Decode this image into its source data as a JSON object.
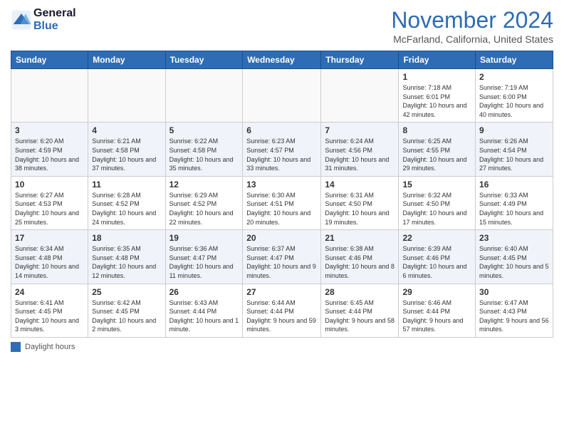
{
  "header": {
    "logo_line1": "General",
    "logo_line2": "Blue",
    "month_title": "November 2024",
    "location": "McFarland, California, United States"
  },
  "legend": {
    "label": "Daylight hours"
  },
  "days_of_week": [
    "Sunday",
    "Monday",
    "Tuesday",
    "Wednesday",
    "Thursday",
    "Friday",
    "Saturday"
  ],
  "weeks": [
    [
      {
        "num": "",
        "info": ""
      },
      {
        "num": "",
        "info": ""
      },
      {
        "num": "",
        "info": ""
      },
      {
        "num": "",
        "info": ""
      },
      {
        "num": "",
        "info": ""
      },
      {
        "num": "1",
        "info": "Sunrise: 7:18 AM\nSunset: 6:01 PM\nDaylight: 10 hours and 42 minutes."
      },
      {
        "num": "2",
        "info": "Sunrise: 7:19 AM\nSunset: 6:00 PM\nDaylight: 10 hours and 40 minutes."
      }
    ],
    [
      {
        "num": "3",
        "info": "Sunrise: 6:20 AM\nSunset: 4:59 PM\nDaylight: 10 hours and 38 minutes."
      },
      {
        "num": "4",
        "info": "Sunrise: 6:21 AM\nSunset: 4:58 PM\nDaylight: 10 hours and 37 minutes."
      },
      {
        "num": "5",
        "info": "Sunrise: 6:22 AM\nSunset: 4:58 PM\nDaylight: 10 hours and 35 minutes."
      },
      {
        "num": "6",
        "info": "Sunrise: 6:23 AM\nSunset: 4:57 PM\nDaylight: 10 hours and 33 minutes."
      },
      {
        "num": "7",
        "info": "Sunrise: 6:24 AM\nSunset: 4:56 PM\nDaylight: 10 hours and 31 minutes."
      },
      {
        "num": "8",
        "info": "Sunrise: 6:25 AM\nSunset: 4:55 PM\nDaylight: 10 hours and 29 minutes."
      },
      {
        "num": "9",
        "info": "Sunrise: 6:26 AM\nSunset: 4:54 PM\nDaylight: 10 hours and 27 minutes."
      }
    ],
    [
      {
        "num": "10",
        "info": "Sunrise: 6:27 AM\nSunset: 4:53 PM\nDaylight: 10 hours and 25 minutes."
      },
      {
        "num": "11",
        "info": "Sunrise: 6:28 AM\nSunset: 4:52 PM\nDaylight: 10 hours and 24 minutes."
      },
      {
        "num": "12",
        "info": "Sunrise: 6:29 AM\nSunset: 4:52 PM\nDaylight: 10 hours and 22 minutes."
      },
      {
        "num": "13",
        "info": "Sunrise: 6:30 AM\nSunset: 4:51 PM\nDaylight: 10 hours and 20 minutes."
      },
      {
        "num": "14",
        "info": "Sunrise: 6:31 AM\nSunset: 4:50 PM\nDaylight: 10 hours and 19 minutes."
      },
      {
        "num": "15",
        "info": "Sunrise: 6:32 AM\nSunset: 4:50 PM\nDaylight: 10 hours and 17 minutes."
      },
      {
        "num": "16",
        "info": "Sunrise: 6:33 AM\nSunset: 4:49 PM\nDaylight: 10 hours and 15 minutes."
      }
    ],
    [
      {
        "num": "17",
        "info": "Sunrise: 6:34 AM\nSunset: 4:48 PM\nDaylight: 10 hours and 14 minutes."
      },
      {
        "num": "18",
        "info": "Sunrise: 6:35 AM\nSunset: 4:48 PM\nDaylight: 10 hours and 12 minutes."
      },
      {
        "num": "19",
        "info": "Sunrise: 6:36 AM\nSunset: 4:47 PM\nDaylight: 10 hours and 11 minutes."
      },
      {
        "num": "20",
        "info": "Sunrise: 6:37 AM\nSunset: 4:47 PM\nDaylight: 10 hours and 9 minutes."
      },
      {
        "num": "21",
        "info": "Sunrise: 6:38 AM\nSunset: 4:46 PM\nDaylight: 10 hours and 8 minutes."
      },
      {
        "num": "22",
        "info": "Sunrise: 6:39 AM\nSunset: 4:46 PM\nDaylight: 10 hours and 6 minutes."
      },
      {
        "num": "23",
        "info": "Sunrise: 6:40 AM\nSunset: 4:45 PM\nDaylight: 10 hours and 5 minutes."
      }
    ],
    [
      {
        "num": "24",
        "info": "Sunrise: 6:41 AM\nSunset: 4:45 PM\nDaylight: 10 hours and 3 minutes."
      },
      {
        "num": "25",
        "info": "Sunrise: 6:42 AM\nSunset: 4:45 PM\nDaylight: 10 hours and 2 minutes."
      },
      {
        "num": "26",
        "info": "Sunrise: 6:43 AM\nSunset: 4:44 PM\nDaylight: 10 hours and 1 minute."
      },
      {
        "num": "27",
        "info": "Sunrise: 6:44 AM\nSunset: 4:44 PM\nDaylight: 9 hours and 59 minutes."
      },
      {
        "num": "28",
        "info": "Sunrise: 6:45 AM\nSunset: 4:44 PM\nDaylight: 9 hours and 58 minutes."
      },
      {
        "num": "29",
        "info": "Sunrise: 6:46 AM\nSunset: 4:44 PM\nDaylight: 9 hours and 57 minutes."
      },
      {
        "num": "30",
        "info": "Sunrise: 6:47 AM\nSunset: 4:43 PM\nDaylight: 9 hours and 56 minutes."
      }
    ]
  ]
}
